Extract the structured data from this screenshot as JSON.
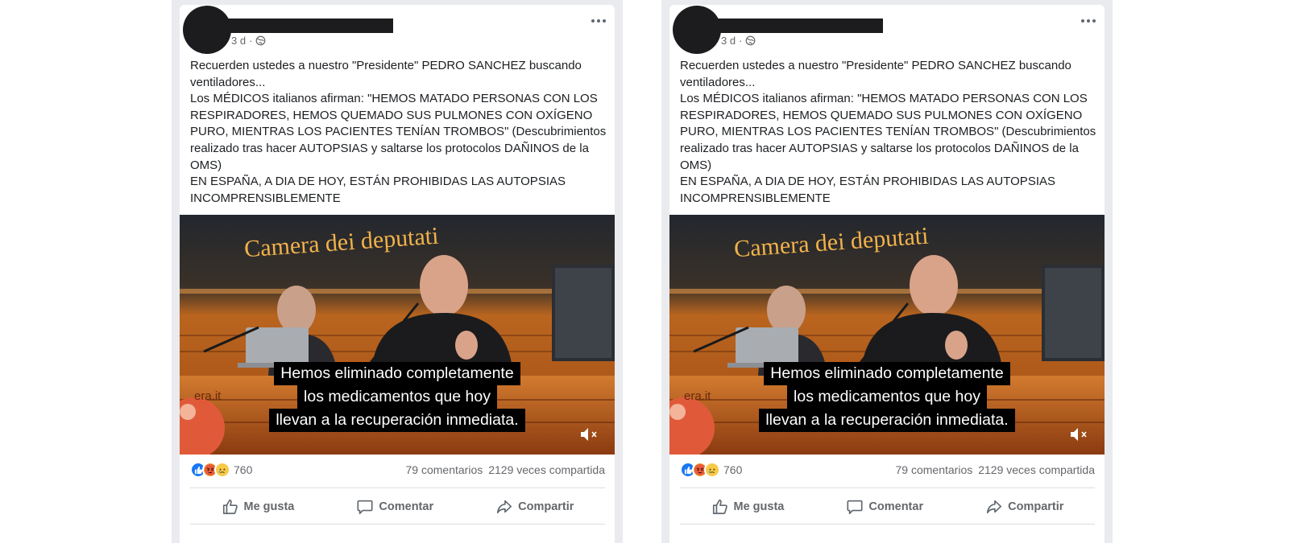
{
  "posts": [
    {
      "time": "3 d",
      "separator": "·",
      "privacy_icon": "globe-icon",
      "menu_icon": "more-options-icon",
      "text_lines": [
        "Recuerden ustedes a nuestro \"Presidente\" PEDRO SANCHEZ buscando ventiladores...",
        "Los MÉDICOS italianos afirman: \"HEMOS MATADO PERSONAS CON LOS RESPIRADORES, HEMOS QUEMADO SUS PULMONES CON OXÍGENO PURO, MIENTRAS LOS PACIENTES TENÍAN TROMBOS\" (Descubrimientos realizado tras hacer AUTOPSIAS y saltarse los protocolos DAÑINOS de la OMS)",
        "EN ESPAÑA, A DIA DE HOY, ESTÁN PROHIBIDAS LAS AUTOPSIAS INCOMPRENSIBLEMENTE"
      ],
      "video": {
        "banner_text": "Camera dei deputati",
        "desk_text": "era.it",
        "subtitles": [
          "Hemos eliminado completamente",
          "los medicamentos que hoy",
          "llevan a la recuperación inmediata."
        ],
        "mute_icon": "speaker-muted-icon"
      },
      "reactions": {
        "icons": [
          "like-icon",
          "angry-icon",
          "sad-icon"
        ],
        "count": "760"
      },
      "comments": "79 comentarios",
      "shares": "2129 veces compartida",
      "actions": {
        "like": "Me gusta",
        "comment": "Comentar",
        "share": "Compartir"
      }
    },
    {
      "time": "3 d",
      "separator": "·",
      "privacy_icon": "globe-icon",
      "menu_icon": "more-options-icon",
      "text_lines": [
        "Recuerden ustedes a nuestro \"Presidente\" PEDRO SANCHEZ buscando ventiladores...",
        "Los MÉDICOS italianos afirman: \"HEMOS MATADO PERSONAS CON LOS RESPIRADORES, HEMOS QUEMADO SUS PULMONES CON OXÍGENO PURO, MIENTRAS LOS PACIENTES TENÍAN TROMBOS\" (Descubrimientos realizado tras hacer AUTOPSIAS y saltarse los protocolos DAÑINOS de la OMS)",
        "EN ESPAÑA, A DIA DE HOY, ESTÁN PROHIBIDAS LAS AUTOPSIAS INCOMPRENSIBLEMENTE"
      ],
      "video": {
        "banner_text": "Camera dei deputati",
        "desk_text": "era.it",
        "subtitles": [
          "Hemos eliminado completamente",
          "los medicamentos que hoy",
          "llevan a la recuperación inmediata."
        ],
        "mute_icon": "speaker-muted-icon"
      },
      "reactions": {
        "icons": [
          "like-icon",
          "angry-icon",
          "sad-icon"
        ],
        "count": "760"
      },
      "comments": "79 comentarios",
      "shares": "2129 veces compartida",
      "actions": {
        "like": "Me gusta",
        "comment": "Comentar",
        "share": "Compartir"
      }
    }
  ],
  "colors": {
    "feed_background": "#e9ebee",
    "card_background": "#ffffff",
    "secondary_text": "#65676b",
    "like_blue": "#1877f2",
    "subtitle_background": "#000000",
    "banner_text": "#f2b24a"
  }
}
